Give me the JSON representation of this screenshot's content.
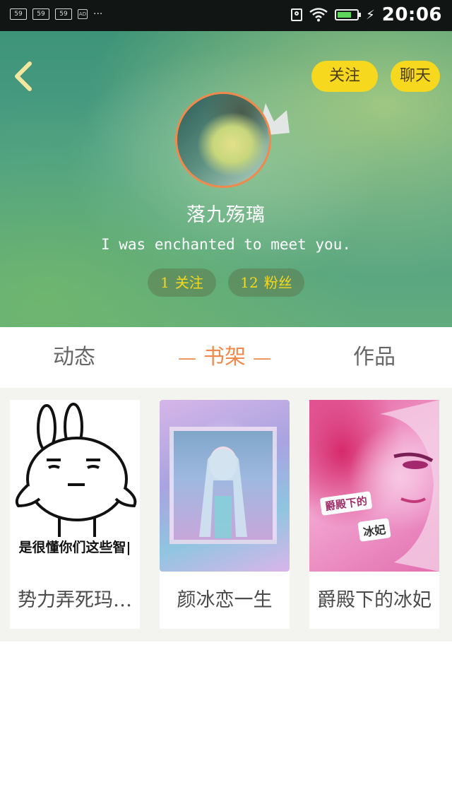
{
  "status_bar": {
    "signal_labels": [
      "59",
      "59",
      "59"
    ],
    "ad_label": "AD",
    "more": "···",
    "time": "20:06",
    "battery_level": 0.6,
    "icons": [
      "signal-icon",
      "ad-icon",
      "location-icon",
      "wifi-icon",
      "battery-icon",
      "charging-icon"
    ]
  },
  "header": {
    "follow_button": "关注",
    "chat_button": "聊天",
    "username": "落九殇璃",
    "bio": "I was enchanted to meet you.",
    "stats": {
      "following_count": "1",
      "following_label": "关注",
      "fans_count": "12",
      "fans_label": "粉丝"
    }
  },
  "tabs": {
    "dynamic": "动态",
    "shelf": "书架",
    "works": "作品",
    "active": "shelf",
    "active_color": "#f08a4c"
  },
  "shelf": {
    "books": [
      {
        "title": "势力弄死玛…",
        "cover_text": "是很懂你们这些智|"
      },
      {
        "title": "颜冰恋一生"
      },
      {
        "title": "爵殿下的冰妃",
        "cover_text_line1": "爵殿下的",
        "cover_text_line2": "冰妃"
      }
    ]
  },
  "colors": {
    "accent": "#f6d81f",
    "orange": "#f08a4c",
    "header_green": "#4a9d86"
  }
}
